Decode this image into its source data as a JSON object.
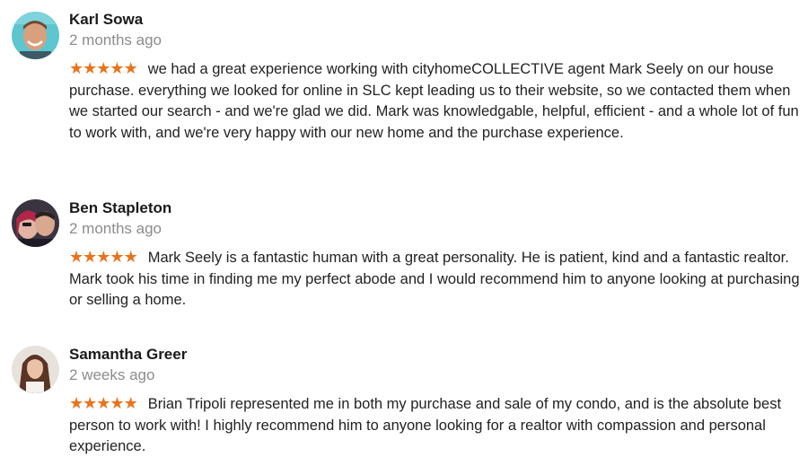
{
  "reviews": [
    {
      "author": "Karl Sowa",
      "time": "2 months ago",
      "rating": 5,
      "text": "we had a great experience working with cityhomeCOLLECTIVE agent Mark Seely on our house purchase. everything we looked for online in SLC kept leading us to their website, so we contacted them when we started our search - and we're glad we did.  Mark was knowledgable, helpful, efficient - and a whole lot of fun to work with, and we're very happy with our new home and the purchase experience."
    },
    {
      "author": "Ben Stapleton",
      "time": "2 months ago",
      "rating": 5,
      "text": "Mark Seely is a fantastic human with a great personality. He is patient, kind and a fantastic realtor. Mark took his time in finding me my perfect abode and I would recommend him to anyone looking at purchasing or selling a home."
    },
    {
      "author": "Samantha Greer",
      "time": "2 weeks ago",
      "rating": 5,
      "text": "Brian Tripoli represented me in both my purchase and sale of my condo, and is the absolute best person to work with! I highly recommend him to anyone looking for a realtor with compassion and personal experience."
    }
  ],
  "colors": {
    "star": "#e8731c",
    "author": "#1a1a1a",
    "time": "#8c8c8c",
    "text": "#222222"
  },
  "icons": {
    "star": "star-icon",
    "avatar": "avatar-photo"
  }
}
